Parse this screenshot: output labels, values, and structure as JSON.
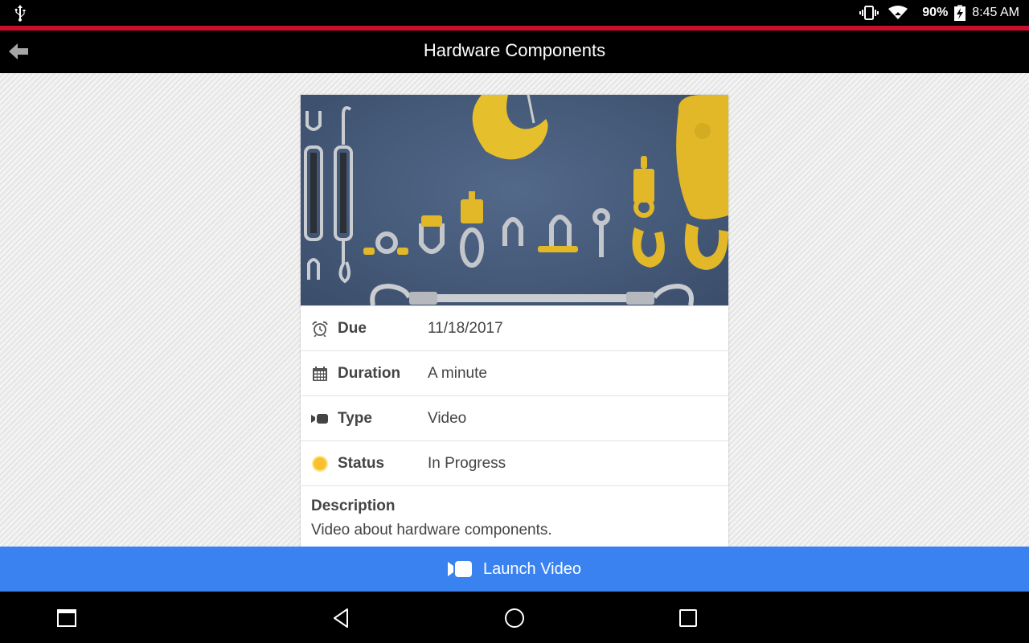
{
  "status_bar": {
    "battery_percent": "90%",
    "time": "8:45 AM",
    "icons": [
      "usb-icon",
      "vibrate-icon",
      "wifi-icon",
      "battery-charging-icon"
    ]
  },
  "app_bar": {
    "title": "Hardware Components",
    "back_icon": "arrow-left-icon"
  },
  "card": {
    "image_alt": "Rigging hardware components: turnbuckles, shackles, hooks, pulley block, wire rope sling",
    "details": [
      {
        "icon": "alarm-clock-icon",
        "label": "Due",
        "value": "11/18/2017"
      },
      {
        "icon": "calendar-icon",
        "label": "Duration",
        "value": "A minute"
      },
      {
        "icon": "video-camera-icon",
        "label": "Type",
        "value": "Video"
      },
      {
        "icon": "status-dot-icon",
        "label": "Status",
        "value": "In Progress"
      }
    ],
    "description_heading": "Description",
    "description_text": "Video about hardware components."
  },
  "launch_button": {
    "label": "Launch Video",
    "icon": "video-camera-icon"
  },
  "colors": {
    "accent_red": "#c8102e",
    "launch_blue": "#3b82f1",
    "status_in_progress": "#fbc02d"
  },
  "nav_bar": {
    "buttons": [
      "screen-pin-icon",
      "back-triangle-icon",
      "home-circle-icon",
      "recents-square-icon"
    ]
  }
}
